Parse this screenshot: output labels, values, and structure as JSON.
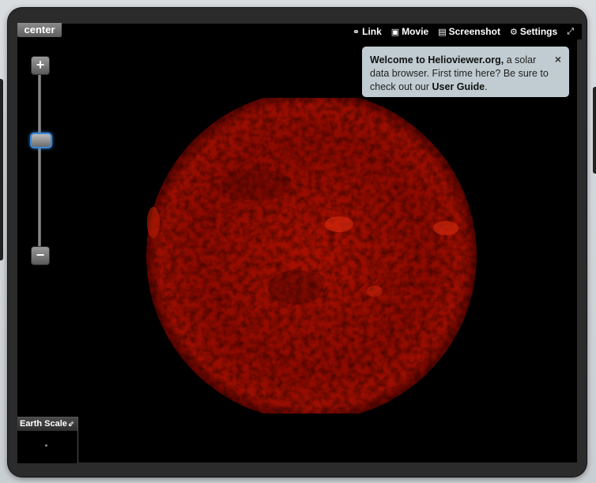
{
  "viewer": {
    "center_label": "center",
    "toolbar": [
      {
        "label": "Link",
        "icon": "link-icon",
        "glyph": "⚭"
      },
      {
        "label": "Movie",
        "icon": "movie-icon",
        "glyph": "▣"
      },
      {
        "label": "Screenshot",
        "icon": "screenshot-icon",
        "glyph": "▤"
      },
      {
        "label": "Settings",
        "icon": "settings-icon",
        "glyph": "⚙"
      }
    ],
    "fullscreen_glyph": "⤢"
  },
  "zoom": {
    "in_glyph": "+",
    "out_glyph": "−",
    "level_fraction": 0.39
  },
  "welcome": {
    "bold_1": "Welcome to Helioviewer.org,",
    "text_1": " a solar data browser. First time here? Be sure to check out our ",
    "bold_2": "User Guide",
    "text_2": ".",
    "close_glyph": "×"
  },
  "earth_scale": {
    "label": "Earth Scale",
    "toggle_glyph": "⇙"
  },
  "colors": {
    "sun_core": "#b01000",
    "sun_edge": "#5a0400",
    "handle_border": "#3a87d6"
  }
}
